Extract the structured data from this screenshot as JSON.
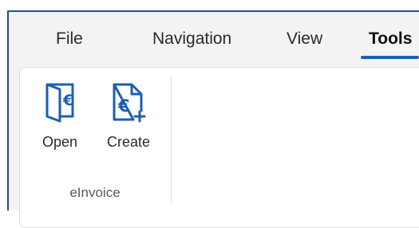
{
  "ribbon": {
    "tabs": [
      {
        "label": "File"
      },
      {
        "label": "Navigation"
      },
      {
        "label": "View"
      },
      {
        "label": "Tools"
      }
    ],
    "active_tab": "Tools"
  },
  "group": {
    "label": "eInvoice",
    "buttons": [
      {
        "label": "Open",
        "icon": "invoice-open-icon"
      },
      {
        "label": "Create",
        "icon": "invoice-create-icon"
      }
    ]
  },
  "colors": {
    "accent": "#1f5fbf",
    "window_border": "#1f4e9c",
    "icon_blue": "#1a5fb4"
  }
}
